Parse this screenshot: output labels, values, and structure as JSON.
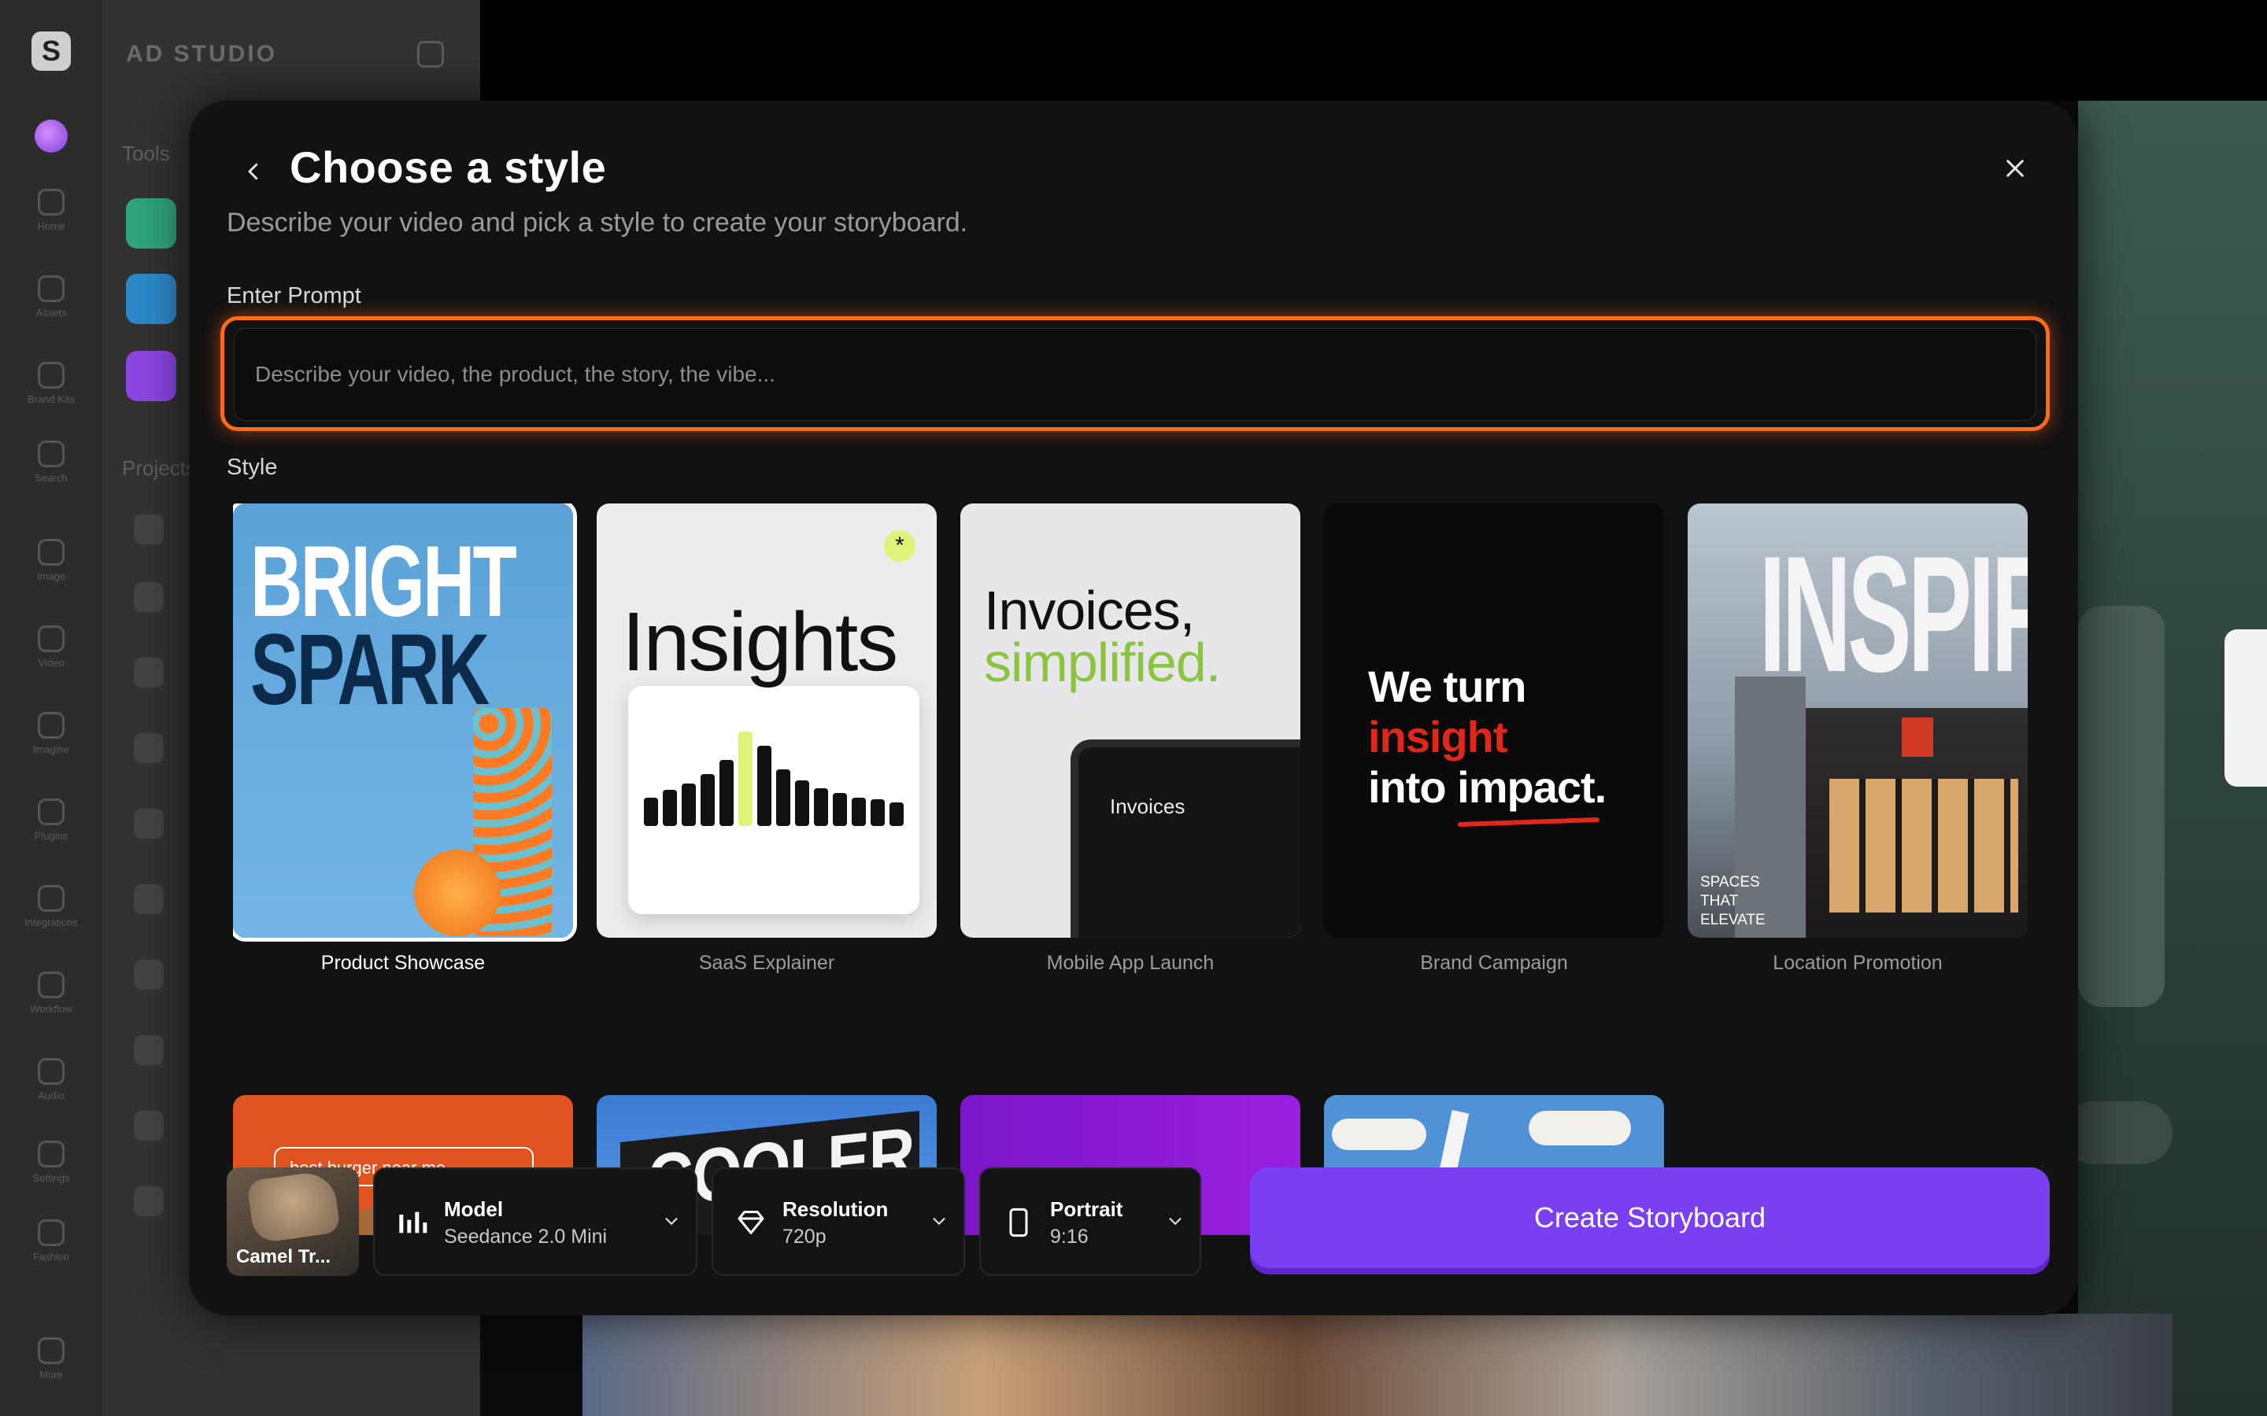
{
  "background": {
    "app_logo": "S",
    "app_name": "AD STUDIO",
    "panel_label": "Tools",
    "projects_label": "Projects",
    "rail_items": [
      "Home",
      "Assets",
      "Brand Kits",
      "Search",
      "Image",
      "Video",
      "Imagine",
      "Plugins",
      "Integrations",
      "Workflow",
      "Audio",
      "Settings",
      "Fashion",
      "More"
    ]
  },
  "modal": {
    "title": "Choose a style",
    "subtitle": "Describe your video and pick a style to create your storyboard.",
    "back_icon": "chevron-left-icon",
    "close_icon": "close-icon",
    "prompt_label": "Enter Prompt",
    "prompt_placeholder": "Describe your video, the product, the story, the vibe...",
    "prompt_value": "",
    "style_label": "Style",
    "styles": [
      {
        "label": "Product Showcase",
        "selected": true,
        "art_text": [
          "BRIGHT",
          "SPARK"
        ]
      },
      {
        "label": "SaaS Explainer",
        "selected": false,
        "art_text": [
          "Insights"
        ]
      },
      {
        "label": "Mobile App Launch",
        "selected": false,
        "art_text": [
          "Invoices,",
          "simplified.",
          "Invoices"
        ]
      },
      {
        "label": "Brand Campaign",
        "selected": false,
        "art_text": [
          "We turn",
          "insight",
          "into impact."
        ]
      },
      {
        "label": "Location Promotion",
        "selected": false,
        "art_text": [
          "INSPIRE",
          "SPACES",
          "THAT",
          "ELEVATE"
        ]
      }
    ],
    "styles_row2": [
      {
        "art_text": "best burger near me"
      },
      {
        "art_text": "COOLER"
      },
      {
        "art_text": ""
      },
      {
        "art_text": ""
      }
    ]
  },
  "footer": {
    "asset_caption": "Camel Tr...",
    "model": {
      "label": "Model",
      "value": "Seedance 2.0 Mini",
      "icon": "bars-icon"
    },
    "resolution": {
      "label": "Resolution",
      "value": "720p",
      "icon": "diamond-icon"
    },
    "aspect": {
      "label": "Portrait",
      "value": "9:16",
      "icon": "phone-icon"
    },
    "create_label": "Create Storyboard"
  },
  "colors": {
    "accent": "#7b3ff2",
    "prompt_focus": "#ff6a1a",
    "highlight_green": "#8bc441",
    "highlight_red": "#e0271c"
  }
}
